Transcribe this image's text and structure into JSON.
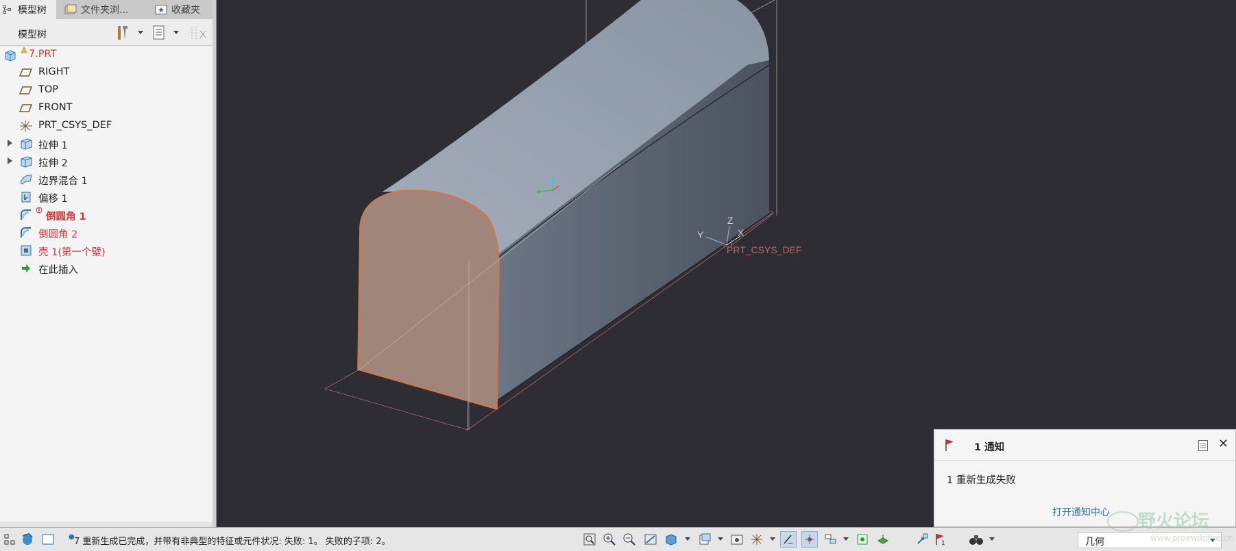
{
  "tabs": [
    {
      "label": "模型树",
      "icon": "tree-icon",
      "active": true
    },
    {
      "label": "文件夹浏...",
      "icon": "folder-browser-icon",
      "active": false
    },
    {
      "label": "收藏夹",
      "icon": "favorites-icon",
      "active": false
    }
  ],
  "model_tree": {
    "title": "模型树",
    "items": [
      {
        "label": "7.PRT",
        "icon": "part-icon",
        "color": "#d9333a",
        "expandable": false
      },
      {
        "label": "RIGHT",
        "icon": "datum-plane-icon",
        "expandable": false
      },
      {
        "label": "TOP",
        "icon": "datum-plane-icon",
        "expandable": false
      },
      {
        "label": "FRONT",
        "icon": "datum-plane-icon",
        "expandable": false
      },
      {
        "label": "PRT_CSYS_DEF",
        "icon": "csys-icon",
        "expandable": false
      },
      {
        "label": "拉伸 1",
        "icon": "extrude-icon",
        "expandable": true
      },
      {
        "label": "拉伸 2",
        "icon": "extrude-icon",
        "expandable": true
      },
      {
        "label": "边界混合 1",
        "icon": "boundary-blend-icon",
        "expandable": false
      },
      {
        "label": "偏移 1",
        "icon": "offset-icon",
        "expandable": false
      },
      {
        "label": "倒圆角 1",
        "icon": "round-icon",
        "color": "#d9333a",
        "bold": true,
        "error": true
      },
      {
        "label": "倒圆角 2",
        "icon": "round-icon",
        "color": "#d9333a"
      },
      {
        "label": "壳 1(第一个壁)",
        "icon": "shell-icon",
        "color": "#d9333a"
      },
      {
        "label": "在此插入",
        "icon": "insert-here-icon"
      }
    ]
  },
  "viewport": {
    "csys_label": "PRT_CSYS_DEF",
    "axes": {
      "x": "X",
      "y": "Y",
      "z": "Z"
    },
    "colors": {
      "background": "#2e2d33",
      "body": "#7f8a99",
      "highlight_face": "#a0857a",
      "highlight_edge": "#e0733a"
    }
  },
  "notification": {
    "title": "1 通知",
    "message": "1 重新生成失败",
    "link": "打开通知中心"
  },
  "status_bar": {
    "message": "7 重新生成已完成，并带有非典型的特征或元件状况: 失败: 1。 失败的子项: 2。",
    "filter_value": "几何"
  },
  "watermark": {
    "text": "野火论坛",
    "url": "www.proewildfire.cn"
  }
}
